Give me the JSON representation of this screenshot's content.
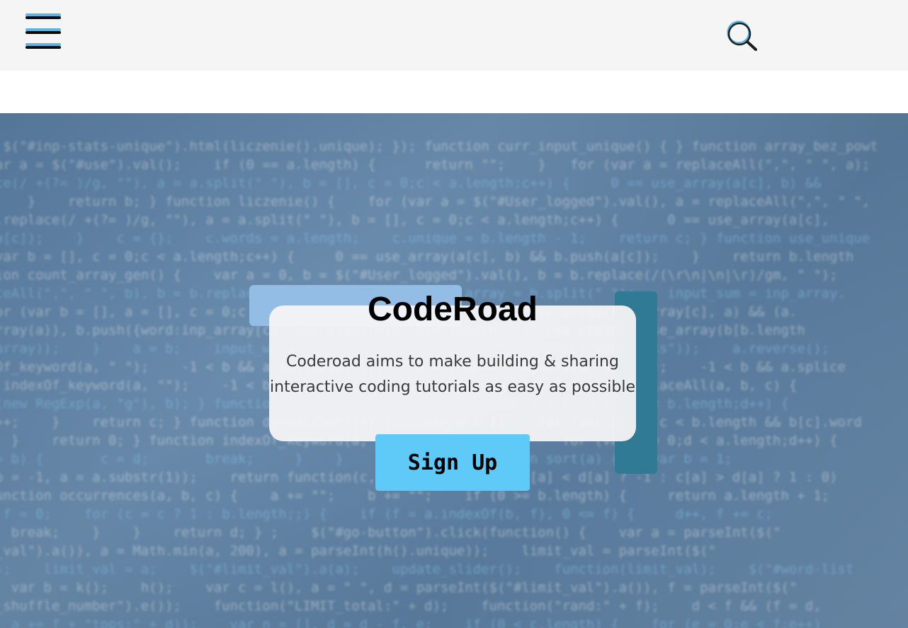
{
  "header": {
    "menu_icon": "hamburger-menu-icon",
    "search_icon": "search-icon"
  },
  "hero": {
    "title": "CodeRoad",
    "description": "Coderoad aims to make building & sharing interactive coding tutorials as easy as possible",
    "cta_label": "Sign Up"
  },
  "colors": {
    "header_bg": "#f5f5f5",
    "button_bg": "#5fcaf7",
    "accent_light": "#94bde6",
    "accent_dark": "#317a96",
    "menu_blue": "#5ab6e0"
  }
}
